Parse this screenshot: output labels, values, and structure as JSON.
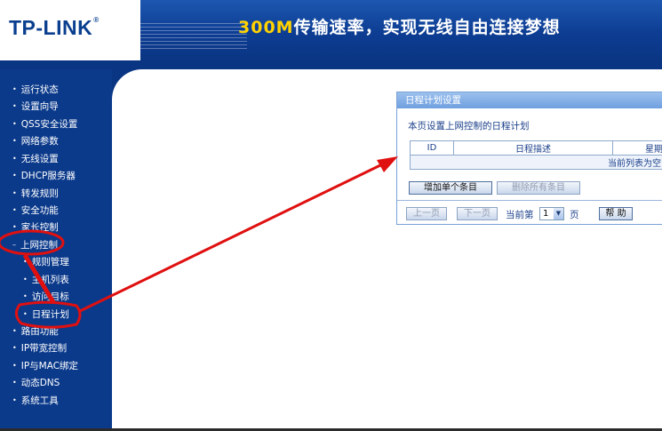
{
  "header": {
    "logo": "TP-LINK",
    "logo_reg": "®",
    "banner_highlight": "300M",
    "banner_text": "传输速率，实现无线自由连接梦想"
  },
  "sidebar": {
    "bullet": "•",
    "sub_bullet": "•",
    "collapse_marker": "–",
    "items": [
      {
        "label": "运行状态"
      },
      {
        "label": "设置向导"
      },
      {
        "label": "QSS安全设置"
      },
      {
        "label": "网络参数"
      },
      {
        "label": "无线设置"
      },
      {
        "label": "DHCP服务器"
      },
      {
        "label": "转发规则"
      },
      {
        "label": "安全功能"
      },
      {
        "label": "家长控制"
      },
      {
        "label": "上网控制"
      },
      {
        "label": "规则管理"
      },
      {
        "label": "主机列表"
      },
      {
        "label": "访问目标"
      },
      {
        "label": "日程计划"
      },
      {
        "label": "路由功能"
      },
      {
        "label": "IP带宽控制"
      },
      {
        "label": "IP与MAC绑定"
      },
      {
        "label": "动态DNS"
      },
      {
        "label": "系统工具"
      }
    ]
  },
  "panel": {
    "title": "日程计划设置",
    "description": "本页设置上网控制的日程计划",
    "table": {
      "headers": [
        "ID",
        "日程描述",
        "星期"
      ],
      "empty_text": "当前列表为空"
    },
    "buttons": {
      "add": "增加单个条目",
      "delete_all": "删除所有条目",
      "prev": "上一页",
      "next": "下一页",
      "help": "帮 助"
    },
    "pager": {
      "current_label": "当前第",
      "page_value": "1",
      "page_unit": "页"
    }
  },
  "colors": {
    "sidebar_bg": "#0b3a8b",
    "annotation_red": "#e01010"
  }
}
